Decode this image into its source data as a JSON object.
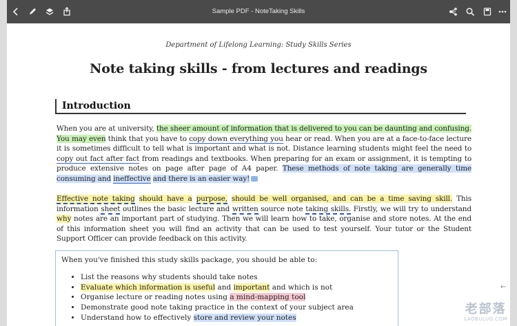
{
  "toolbar": {
    "title": "Sample PDF - NoteTaking Skills",
    "left_icons": [
      "back-icon",
      "pen-icon",
      "layers-icon",
      "share-icon"
    ],
    "right_icons": [
      "tree-icon",
      "search-icon",
      "save-icon",
      "more-icon"
    ]
  },
  "document": {
    "series": "Department of Lifelong Learning: Study Skills Series",
    "title": "Note taking skills - from lectures and readings",
    "section_heading": "Introduction",
    "p1": {
      "s1": "When you are at university,",
      "s2": "the sheer amount of information that is delivered to you can be daunting and confusing.",
      "s3": "You may even",
      "s4": "think that you have to",
      "s5": "copy down everything you",
      "s6": "hear or read. When you are at a face-to-face lecture it is sometimes difficult to tell what is important and what is not. Distance learning students might feel the need to",
      "s7": "copy out fact after fact",
      "s8": "from readings and textbooks. When preparing for an exam or assignment, it is tempting to produce extensive notes on page after page of A4 paper.",
      "s9": "These methods of note taking are generally time consuming and",
      "s10": "ineffective",
      "s11": "and there is an easier way!"
    },
    "p2": {
      "s1": "Effective note taking",
      "s2": "should have a",
      "s3": "purpose,",
      "s4": "should be well organised, and can be a time saving skill.",
      "s5": "This information",
      "s6": "sheet",
      "s7": "outlines the basic lecture and",
      "s8": "written",
      "s9": "source note",
      "s10": "taking skills.",
      "s11": "Firstly, we will try to understand",
      "s12": "why",
      "s13": "notes are an important part of studying. Then we will learn how to take, organise and store notes. At the end of this information sheet you will find an activity that can be used to test yourself. Your tutor or the Student Support Officer can provide feedback on this activity."
    },
    "box": {
      "intro": "When you've finished this study skills package, you should be able to:",
      "items": [
        {
          "a": "List the reasons why students should take notes"
        },
        {
          "a": "Evaluate which information is useful",
          "b": "and",
          "c": "important",
          "d": "and which is not"
        },
        {
          "a": "Organise lecture or reading notes using",
          "b": "a mind-mapping tool"
        },
        {
          "a": "Demonstrate good note taking practice in the context of your subject area"
        },
        {
          "a": "Understand how to effectively",
          "b": "store and review your notes"
        }
      ]
    }
  },
  "watermark": {
    "main": "老部落",
    "sub": "LAOBULUO.COM"
  },
  "colors": {
    "toolbar": "#4a4a4a",
    "highlight_green": "#c9f2b5",
    "highlight_yellow": "#fbf3a6",
    "highlight_blue": "#cfe0fb",
    "highlight_pink": "#f7c9d1",
    "underline_blue": "#3b67c9"
  }
}
